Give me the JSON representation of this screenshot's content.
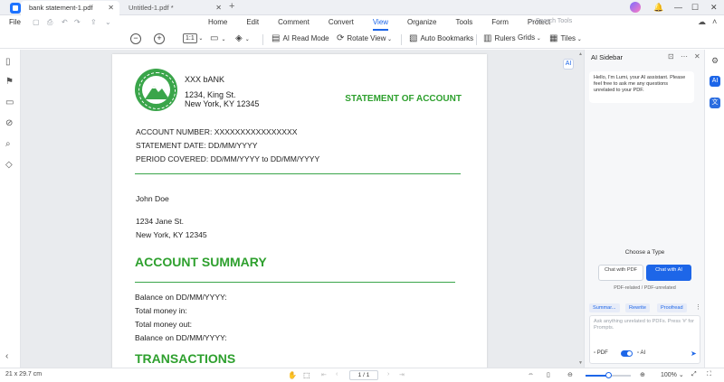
{
  "tabs": [
    {
      "label": "bank statement-1.pdf",
      "active": true
    },
    {
      "label": "Untitled-1.pdf *",
      "active": false
    }
  ],
  "tab_add": "+",
  "window": {
    "minimize": "—",
    "maximize": "☐",
    "close": "✕"
  },
  "menubar": {
    "file": "File",
    "items": [
      "Home",
      "Edit",
      "Comment",
      "Convert",
      "View",
      "Organize",
      "Tools",
      "Form",
      "Protect"
    ],
    "active": "View",
    "search_placeholder": "Search Tools"
  },
  "toolbar": {
    "zoom_out": "−",
    "zoom_in": "+",
    "page_fit": "1:1",
    "ai_read_mode": "AI Read Mode",
    "rotate_view": "Rotate View",
    "auto_bookmarks": "Auto Bookmarks",
    "rulers": "Rulers",
    "grids": "Grids",
    "tiles": "Tiles"
  },
  "document": {
    "bank_name": "XXX bANK",
    "bank_address_line1": "1234, King St.",
    "bank_address_line2": "New York, KY 12345",
    "statement_title": "STATEMENT OF ACCOUNT",
    "account_number": "ACCOUNT NUMBER: XXXXXXXXXXXXXXXX",
    "statement_date": "STATEMENT DATE: DD/MM/YYYY",
    "period_covered": "PERIOD COVERED: DD/MM/YYYY to DD/MM/YYYY",
    "customer_name": "John Doe",
    "customer_address_line1": "1234 Jane St.",
    "customer_address_line2": "New York, KY 12345",
    "summary_title": "ACCOUNT SUMMARY",
    "summary_lines": [
      "Balance on DD/MM/YYYY:",
      "Total money in:",
      "Total money out:",
      "Balance on DD/MM/YYYY:"
    ],
    "transactions_title": "TRANSACTIONS"
  },
  "ai_sidebar": {
    "title": "AI Sidebar",
    "greeting": "Hello, I'm Lumi, your AI assistant. Please feel free to ask me any questions unrelated to your PDF.",
    "choose_type": "Choose a Type",
    "chat_with_pdf": "Chat with PDF",
    "chat_with_ai": "Chat with AI",
    "choice_subtitle": "PDF-related / PDF-unrelated",
    "chips": [
      "Summar...",
      "Rewrite",
      "Proofread"
    ],
    "input_placeholder": "Ask anything unrelated to PDFs. Press '#' for Prompts.",
    "option_pdf": "PDF",
    "option_ai": "AI"
  },
  "statusbar": {
    "page_size": "21 x 29.7 cm",
    "page_indicator": "1 / 1",
    "zoom": "100%",
    "zoom_level_fraction": 0.5
  },
  "colors": {
    "accent": "#1d66e8",
    "doc_green": "#2ea02e"
  }
}
